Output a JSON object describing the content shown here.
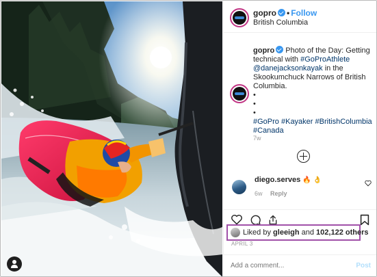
{
  "post": {
    "username": "gopro",
    "follow_label": "Follow",
    "location": "British Columbia",
    "caption": {
      "username": "gopro",
      "text_intro": "Photo of the Day: Getting technical with",
      "tag_athlete": "#GoProAthlete",
      "mention": "@danejacksonkayak",
      "text_rest": "in the Skookumchuck Narrows of British Columbia.",
      "bullets": [
        "•",
        "•",
        "•"
      ],
      "hashtags": [
        "#GoPro",
        "#Kayaker",
        "#BritishColumbia",
        "#Canada"
      ],
      "age": "7w"
    },
    "comment": {
      "username": "diego.serves",
      "emoji": "🔥 👌",
      "age": "6w",
      "reply_label": "Reply"
    },
    "likes": {
      "prefix": "Liked by",
      "liker": "gleeigh",
      "joiner": "and",
      "others": "102,122 others"
    },
    "date": "APRIL 3",
    "add_comment": {
      "placeholder": "Add a comment...",
      "post_label": "Post"
    }
  },
  "icons": {
    "verified": "verified-badge-icon",
    "load_more": "plus-circle-icon",
    "like": "heart-icon",
    "comment": "comment-icon",
    "share": "share-icon",
    "save": "bookmark-icon",
    "user_tag": "user-icon"
  },
  "colors": {
    "follow": "#3897f0",
    "highlight_box": "#a050a8",
    "hashtag": "#003569",
    "post_disabled": "#b2dffc"
  }
}
